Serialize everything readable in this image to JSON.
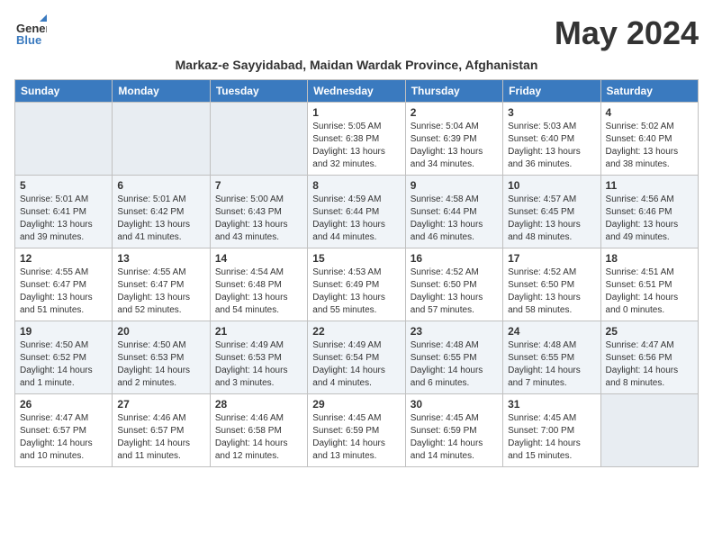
{
  "header": {
    "logo_line1": "General",
    "logo_line2": "Blue",
    "month_title": "May 2024",
    "location": "Markaz-e Sayyidabad, Maidan Wardak Province, Afghanistan"
  },
  "days_of_week": [
    "Sunday",
    "Monday",
    "Tuesday",
    "Wednesday",
    "Thursday",
    "Friday",
    "Saturday"
  ],
  "weeks": [
    [
      {
        "num": "",
        "detail": ""
      },
      {
        "num": "",
        "detail": ""
      },
      {
        "num": "",
        "detail": ""
      },
      {
        "num": "1",
        "detail": "Sunrise: 5:05 AM\nSunset: 6:38 PM\nDaylight: 13 hours and 32 minutes."
      },
      {
        "num": "2",
        "detail": "Sunrise: 5:04 AM\nSunset: 6:39 PM\nDaylight: 13 hours and 34 minutes."
      },
      {
        "num": "3",
        "detail": "Sunrise: 5:03 AM\nSunset: 6:40 PM\nDaylight: 13 hours and 36 minutes."
      },
      {
        "num": "4",
        "detail": "Sunrise: 5:02 AM\nSunset: 6:40 PM\nDaylight: 13 hours and 38 minutes."
      }
    ],
    [
      {
        "num": "5",
        "detail": "Sunrise: 5:01 AM\nSunset: 6:41 PM\nDaylight: 13 hours and 39 minutes."
      },
      {
        "num": "6",
        "detail": "Sunrise: 5:01 AM\nSunset: 6:42 PM\nDaylight: 13 hours and 41 minutes."
      },
      {
        "num": "7",
        "detail": "Sunrise: 5:00 AM\nSunset: 6:43 PM\nDaylight: 13 hours and 43 minutes."
      },
      {
        "num": "8",
        "detail": "Sunrise: 4:59 AM\nSunset: 6:44 PM\nDaylight: 13 hours and 44 minutes."
      },
      {
        "num": "9",
        "detail": "Sunrise: 4:58 AM\nSunset: 6:44 PM\nDaylight: 13 hours and 46 minutes."
      },
      {
        "num": "10",
        "detail": "Sunrise: 4:57 AM\nSunset: 6:45 PM\nDaylight: 13 hours and 48 minutes."
      },
      {
        "num": "11",
        "detail": "Sunrise: 4:56 AM\nSunset: 6:46 PM\nDaylight: 13 hours and 49 minutes."
      }
    ],
    [
      {
        "num": "12",
        "detail": "Sunrise: 4:55 AM\nSunset: 6:47 PM\nDaylight: 13 hours and 51 minutes."
      },
      {
        "num": "13",
        "detail": "Sunrise: 4:55 AM\nSunset: 6:47 PM\nDaylight: 13 hours and 52 minutes."
      },
      {
        "num": "14",
        "detail": "Sunrise: 4:54 AM\nSunset: 6:48 PM\nDaylight: 13 hours and 54 minutes."
      },
      {
        "num": "15",
        "detail": "Sunrise: 4:53 AM\nSunset: 6:49 PM\nDaylight: 13 hours and 55 minutes."
      },
      {
        "num": "16",
        "detail": "Sunrise: 4:52 AM\nSunset: 6:50 PM\nDaylight: 13 hours and 57 minutes."
      },
      {
        "num": "17",
        "detail": "Sunrise: 4:52 AM\nSunset: 6:50 PM\nDaylight: 13 hours and 58 minutes."
      },
      {
        "num": "18",
        "detail": "Sunrise: 4:51 AM\nSunset: 6:51 PM\nDaylight: 14 hours and 0 minutes."
      }
    ],
    [
      {
        "num": "19",
        "detail": "Sunrise: 4:50 AM\nSunset: 6:52 PM\nDaylight: 14 hours and 1 minute."
      },
      {
        "num": "20",
        "detail": "Sunrise: 4:50 AM\nSunset: 6:53 PM\nDaylight: 14 hours and 2 minutes."
      },
      {
        "num": "21",
        "detail": "Sunrise: 4:49 AM\nSunset: 6:53 PM\nDaylight: 14 hours and 3 minutes."
      },
      {
        "num": "22",
        "detail": "Sunrise: 4:49 AM\nSunset: 6:54 PM\nDaylight: 14 hours and 4 minutes."
      },
      {
        "num": "23",
        "detail": "Sunrise: 4:48 AM\nSunset: 6:55 PM\nDaylight: 14 hours and 6 minutes."
      },
      {
        "num": "24",
        "detail": "Sunrise: 4:48 AM\nSunset: 6:55 PM\nDaylight: 14 hours and 7 minutes."
      },
      {
        "num": "25",
        "detail": "Sunrise: 4:47 AM\nSunset: 6:56 PM\nDaylight: 14 hours and 8 minutes."
      }
    ],
    [
      {
        "num": "26",
        "detail": "Sunrise: 4:47 AM\nSunset: 6:57 PM\nDaylight: 14 hours and 10 minutes."
      },
      {
        "num": "27",
        "detail": "Sunrise: 4:46 AM\nSunset: 6:57 PM\nDaylight: 14 hours and 11 minutes."
      },
      {
        "num": "28",
        "detail": "Sunrise: 4:46 AM\nSunset: 6:58 PM\nDaylight: 14 hours and 12 minutes."
      },
      {
        "num": "29",
        "detail": "Sunrise: 4:45 AM\nSunset: 6:59 PM\nDaylight: 14 hours and 13 minutes."
      },
      {
        "num": "30",
        "detail": "Sunrise: 4:45 AM\nSunset: 6:59 PM\nDaylight: 14 hours and 14 minutes."
      },
      {
        "num": "31",
        "detail": "Sunrise: 4:45 AM\nSunset: 7:00 PM\nDaylight: 14 hours and 15 minutes."
      },
      {
        "num": "",
        "detail": ""
      }
    ]
  ]
}
